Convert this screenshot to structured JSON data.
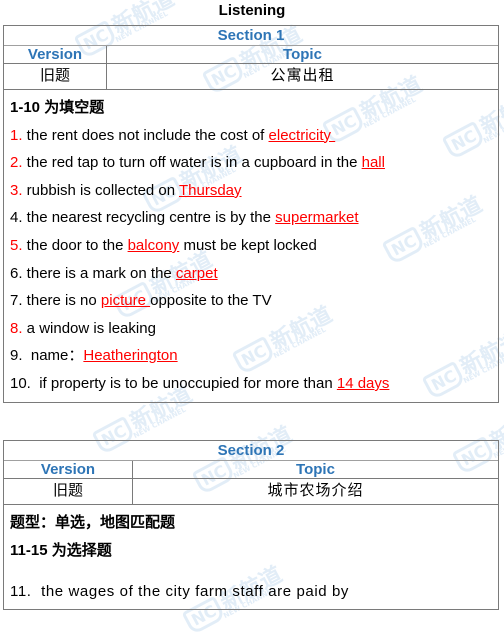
{
  "title": "Listening",
  "watermark": {
    "logo": "NC",
    "cn": "新航道",
    "en": "NEW CHANNEL"
  },
  "colors": {
    "section_blue": "#2e75b6",
    "answer_red": "#ff0000",
    "border": "#7a7a7a"
  },
  "sections": [
    {
      "section_label": "Section 1",
      "version_header": "Version",
      "topic_header": "Topic",
      "version": "旧题",
      "topic": "公寓出租",
      "intro": "1-10 为填空题",
      "items": [
        {
          "num": "1.",
          "num_red": true,
          "text": " the rent does not include the cost of ",
          "answer": "electricity ",
          "after": ""
        },
        {
          "num": "2.",
          "num_red": true,
          "text": " the red tap to turn off water is in a cupboard in the ",
          "answer": "hall",
          "after": ""
        },
        {
          "num": "3.",
          "num_red": true,
          "text": " rubbish is collected on ",
          "answer": "Thursday",
          "after": ""
        },
        {
          "num": "4.",
          "num_red": false,
          "text": " the nearest recycling centre is by the ",
          "answer": "supermarket",
          "after": ""
        },
        {
          "num": "5.",
          "num_red": true,
          "text": " the door to the ",
          "answer": "balcony",
          "after": " must be kept locked"
        },
        {
          "num": "6.",
          "num_red": false,
          "text": " there is a mark on the ",
          "answer": "carpet",
          "after": ""
        },
        {
          "num": "7.",
          "num_red": false,
          "text": " there is no ",
          "answer": "picture ",
          "after": "opposite to the TV"
        },
        {
          "num": "8.",
          "num_red": true,
          "text": " a window is leaking",
          "answer": "",
          "after": ""
        },
        {
          "num": "9.",
          "num_red": false,
          "text": "  name：",
          "answer": "Heatherington",
          "after": ""
        },
        {
          "num": "10.",
          "num_red": false,
          "text": "  if property is to be unoccupied for more than ",
          "answer": "14 days",
          "after": ""
        }
      ]
    },
    {
      "section_label": "Section 2",
      "version_header": "Version",
      "topic_header": "Topic",
      "version": "旧题",
      "topic": "城市农场介绍",
      "question_type": "题型：单选，地图匹配题",
      "intro": "11-15 为选择题",
      "items": [
        {
          "num": "11.",
          "text": "  the wages of the city farm staff are paid by"
        }
      ]
    }
  ]
}
